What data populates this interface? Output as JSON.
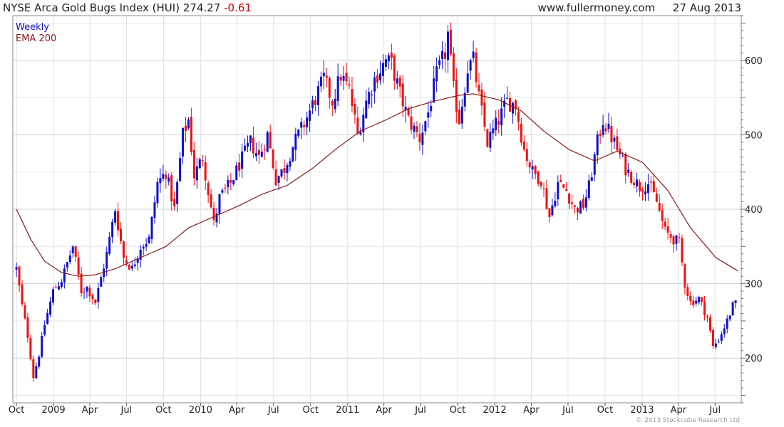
{
  "header": {
    "title": "NYSE Arca Gold Bugs Index (HUI)",
    "last": "274.27",
    "change": "-0.61",
    "source": "www.fullermoney.com",
    "date": "27 Aug 2013"
  },
  "footer": {
    "copyright": "© 2013 Stockcube Research Ltd"
  },
  "colors": {
    "up": "#1010cc",
    "down": "#ee1111",
    "ema": "#8b1a1a",
    "grid": "#d8d8d8",
    "text": "#222222"
  },
  "chart_data": {
    "type": "candlestick",
    "title": "NYSE Arca Gold Bugs Index (HUI) 274.27 -0.61",
    "legend": [
      "Weekly",
      "EMA 200"
    ],
    "legend_placement": "top-left",
    "y_axis_side": "right",
    "ylim": [
      140,
      660
    ],
    "yticks": [
      200,
      300,
      400,
      500,
      600
    ],
    "x_tick_labels": [
      "Oct",
      "2009",
      "Apr",
      "Jul",
      "Oct",
      "2010",
      "Apr",
      "Jul",
      "Oct",
      "2011",
      "Apr",
      "Jul",
      "Oct",
      "2012",
      "Apr",
      "Jul",
      "Oct",
      "2013",
      "Apr",
      "Jul"
    ],
    "grid": true,
    "weekly_close_path": [
      [
        "2008-10-01",
        320
      ],
      [
        "2008-10-15",
        270
      ],
      [
        "2008-10-29",
        230
      ],
      [
        "2008-11-12",
        175
      ],
      [
        "2008-11-26",
        205
      ],
      [
        "2008-12-10",
        245
      ],
      [
        "2008-12-31",
        290
      ],
      [
        "2009-01-21",
        305
      ],
      [
        "2009-02-18",
        350
      ],
      [
        "2009-03-11",
        290
      ],
      [
        "2009-03-25",
        295
      ],
      [
        "2009-04-15",
        275
      ],
      [
        "2009-05-13",
        340
      ],
      [
        "2009-06-03",
        400
      ],
      [
        "2009-06-24",
        335
      ],
      [
        "2009-07-15",
        320
      ],
      [
        "2009-08-05",
        350
      ],
      [
        "2009-08-26",
        360
      ],
      [
        "2009-09-16",
        435
      ],
      [
        "2009-10-07",
        450
      ],
      [
        "2009-10-28",
        400
      ],
      [
        "2009-11-18",
        500
      ],
      [
        "2009-12-02",
        520
      ],
      [
        "2009-12-16",
        445
      ],
      [
        "2010-01-06",
        470
      ],
      [
        "2010-02-03",
        380
      ],
      [
        "2010-02-17",
        415
      ],
      [
        "2010-03-17",
        435
      ],
      [
        "2010-04-07",
        460
      ],
      [
        "2010-05-05",
        490
      ],
      [
        "2010-05-26",
        470
      ],
      [
        "2010-06-16",
        500
      ],
      [
        "2010-07-07",
        440
      ],
      [
        "2010-07-28",
        455
      ],
      [
        "2010-08-18",
        485
      ],
      [
        "2010-09-15",
        515
      ],
      [
        "2010-10-06",
        540
      ],
      [
        "2010-11-03",
        575
      ],
      [
        "2010-11-24",
        545
      ],
      [
        "2010-12-15",
        580
      ],
      [
        "2011-01-05",
        560
      ],
      [
        "2011-01-26",
        500
      ],
      [
        "2011-02-16",
        545
      ],
      [
        "2011-03-09",
        575
      ],
      [
        "2011-04-06",
        600
      ],
      [
        "2011-04-20",
        595
      ],
      [
        "2011-05-11",
        555
      ],
      [
        "2011-06-01",
        520
      ],
      [
        "2011-06-29",
        495
      ],
      [
        "2011-07-20",
        530
      ],
      [
        "2011-08-10",
        580
      ],
      [
        "2011-08-31",
        610
      ],
      [
        "2011-09-07",
        635
      ],
      [
        "2011-09-21",
        560
      ],
      [
        "2011-10-05",
        520
      ],
      [
        "2011-10-26",
        590
      ],
      [
        "2011-11-09",
        600
      ],
      [
        "2011-11-23",
        550
      ],
      [
        "2011-12-14",
        490
      ],
      [
        "2012-01-11",
        520
      ],
      [
        "2012-02-01",
        545
      ],
      [
        "2012-02-22",
        540
      ],
      [
        "2012-03-14",
        480
      ],
      [
        "2012-04-04",
        450
      ],
      [
        "2012-04-25",
        440
      ],
      [
        "2012-05-16",
        390
      ],
      [
        "2012-06-06",
        435
      ],
      [
        "2012-06-27",
        425
      ],
      [
        "2012-07-18",
        400
      ],
      [
        "2012-08-08",
        405
      ],
      [
        "2012-08-22",
        430
      ],
      [
        "2012-09-12",
        490
      ],
      [
        "2012-09-26",
        520
      ],
      [
        "2012-10-10",
        505
      ],
      [
        "2012-10-31",
        480
      ],
      [
        "2012-11-21",
        455
      ],
      [
        "2012-12-12",
        440
      ],
      [
        "2012-12-26",
        430
      ],
      [
        "2013-01-16",
        435
      ],
      [
        "2013-02-06",
        410
      ],
      [
        "2013-02-27",
        370
      ],
      [
        "2013-03-20",
        360
      ],
      [
        "2013-04-03",
        355
      ],
      [
        "2013-04-17",
        300
      ],
      [
        "2013-05-01",
        275
      ],
      [
        "2013-05-22",
        280
      ],
      [
        "2013-06-12",
        255
      ],
      [
        "2013-06-26",
        215
      ],
      [
        "2013-07-10",
        225
      ],
      [
        "2013-07-31",
        250
      ],
      [
        "2013-08-14",
        270
      ],
      [
        "2013-08-27",
        274.27
      ]
    ],
    "ema200": [
      [
        "2008-10-01",
        400
      ],
      [
        "2008-11-05",
        360
      ],
      [
        "2008-12-10",
        330
      ],
      [
        "2009-01-21",
        315
      ],
      [
        "2009-03-04",
        310
      ],
      [
        "2009-04-15",
        312
      ],
      [
        "2009-06-03",
        320
      ],
      [
        "2009-08-05",
        335
      ],
      [
        "2009-10-07",
        350
      ],
      [
        "2009-12-02",
        375
      ],
      [
        "2010-02-03",
        390
      ],
      [
        "2010-04-07",
        405
      ],
      [
        "2010-06-02",
        420
      ],
      [
        "2010-08-04",
        432
      ],
      [
        "2010-10-06",
        455
      ],
      [
        "2010-12-01",
        480
      ],
      [
        "2011-02-02",
        505
      ],
      [
        "2011-04-06",
        520
      ],
      [
        "2011-06-01",
        535
      ],
      [
        "2011-08-03",
        545
      ],
      [
        "2011-10-05",
        553
      ],
      [
        "2011-11-09",
        555
      ],
      [
        "2012-01-11",
        547
      ],
      [
        "2012-03-07",
        532
      ],
      [
        "2012-05-02",
        505
      ],
      [
        "2012-07-04",
        480
      ],
      [
        "2012-09-05",
        465
      ],
      [
        "2012-10-31",
        478
      ],
      [
        "2013-01-02",
        463
      ],
      [
        "2013-03-06",
        425
      ],
      [
        "2013-05-01",
        375
      ],
      [
        "2013-07-03",
        335
      ],
      [
        "2013-08-27",
        317
      ]
    ]
  }
}
